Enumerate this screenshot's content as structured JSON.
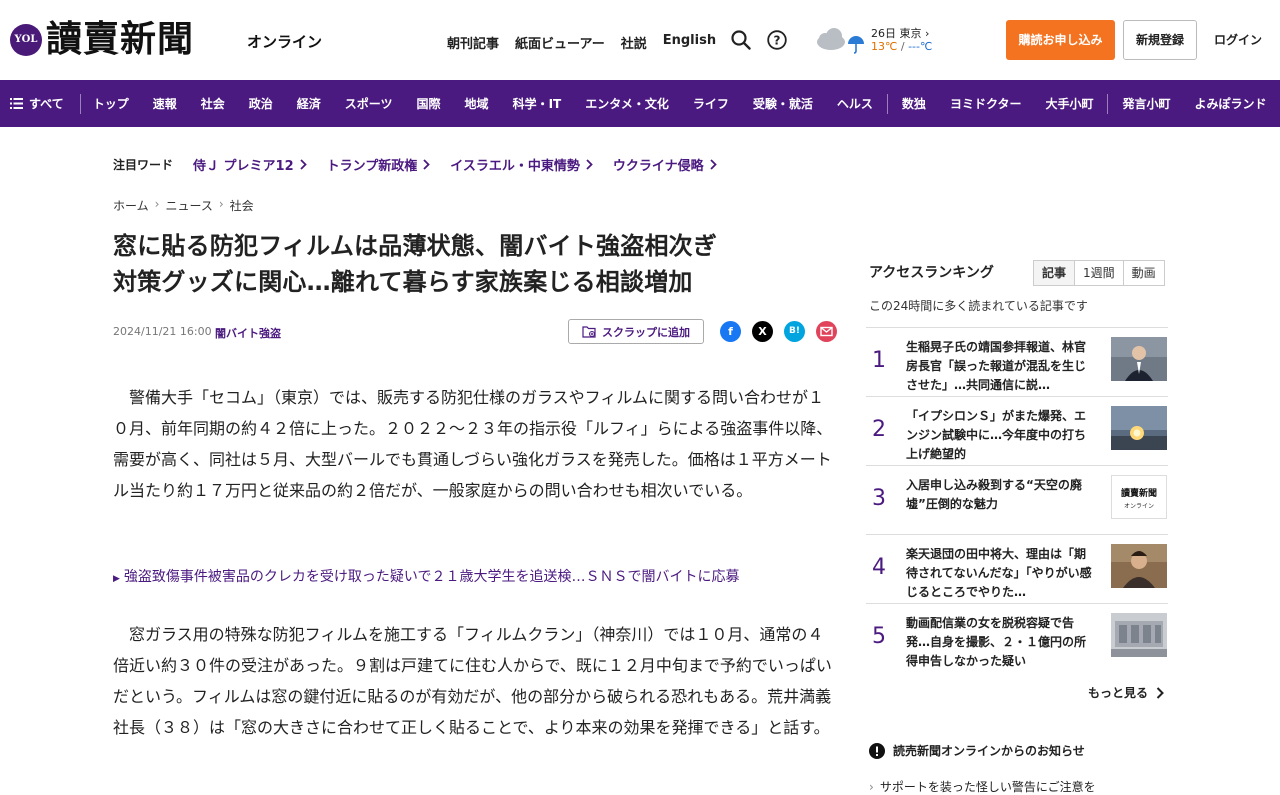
{
  "header": {
    "logo_badge": "YOL",
    "logo_main": "讀賣新聞",
    "logo_sub": "オンライン",
    "links": [
      "朝刊記事",
      "紙面ビューアー",
      "社説",
      "English"
    ],
    "weather": {
      "date_city": "26日 東京",
      "chevron": "›",
      "temp_high": "13℃",
      "sep": "/",
      "temp_low": "---℃"
    },
    "subscribe": "購読お申し込み",
    "register": "新規登録",
    "login": "ログイン"
  },
  "nav": {
    "all": "すべて",
    "items_a": [
      "トップ",
      "速報",
      "社会",
      "政治",
      "経済",
      "スポーツ",
      "国際",
      "地域",
      "科学・IT",
      "エンタメ・文化",
      "ライフ",
      "受験・就活",
      "ヘルス"
    ],
    "items_b": [
      "数独",
      "ヨミドクター",
      "大手小町"
    ],
    "items_c": [
      "発言小町",
      "よみぽランド"
    ]
  },
  "attention": {
    "label": "注目ワード",
    "links": [
      "侍Ｊ プレミア12",
      "トランプ新政権",
      "イスラエル・中東情勢",
      "ウクライナ侵略"
    ]
  },
  "breadcrumb": {
    "home": "ホーム",
    "news": "ニュース",
    "section": "社会",
    "sep": "›"
  },
  "article": {
    "title_line1": "窓に貼る防犯フィルムは品薄状態、闇バイト強盗相次ぎ",
    "title_line2": "対策グッズに関心…離れて暮らす家族案じる相談増加",
    "date": "2024/11/21 16:00",
    "tag": "闇バイト強盗",
    "scrap": "スクラップに追加",
    "para1": "警備大手「セコム」（東京）では、販売する防犯仕様のガラスやフィルムに関する問い合わせが１０月、前年同期の約４２倍に上った。２０２２～２３年の指示役「ルフィ」らによる強盗事件以降、需要が高く、同社は５月、大型バールでも貫通しづらい強化ガラスを発売した。価格は１平方メートル当たり約１７万円と従来品の約２倍だが、一般家庭からの問い合わせも相次いでいる。",
    "related": "強盗致傷事件被害品のクレカを受け取った疑いで２１歳大学生を追送検…ＳＮＳで闇バイトに応募",
    "para2": "窓ガラス用の特殊な防犯フィルムを施工する「フィルムクラン」（神奈川）では１０月、通常の４倍近い約３０件の受注があった。９割は戸建てに住む人からで、既に１２月中旬まで予約でいっぱいだという。フィルムは窓の鍵付近に貼るのが有効だが、他の部分から破られる恐れもある。荒井満義社長（３８）は「窓の大きさに合わせて正しく貼ることで、より本来の効果を発揮できる」と話す。"
  },
  "share": {
    "facebook": "f",
    "x": "X",
    "hatena": "B!"
  },
  "ranking": {
    "title": "アクセスランキング",
    "tabs": [
      "記事",
      "1週間",
      "動画"
    ],
    "subtitle": "この24時間に多く読まれている記事です",
    "items": [
      {
        "num": "1",
        "text": "生稲晃子氏の靖国参拝報道、林官房長官「誤った報道が混乱を生じさせた」…共同通信に説…"
      },
      {
        "num": "2",
        "text": "「イプシロンＳ」がまた爆発、エンジン試験中に…今年度中の打ち上げ絶望的"
      },
      {
        "num": "3",
        "text": "入居申し込み殺到する“天空の廃墟”圧倒的な魅力"
      },
      {
        "num": "4",
        "text": "楽天退団の田中将大、理由は「期待されてないんだな」「やりがい感じるところでやりた…"
      },
      {
        "num": "5",
        "text": "動画配信業の女を脱税容疑で告発…自身を撮影、２・１億円の所得申告しなかった疑い"
      }
    ],
    "thumb3_line1": "讀賣新聞",
    "thumb3_line2": "オンライン",
    "more": "もっと見る"
  },
  "notice": {
    "title": "読売新聞オンラインからのお知らせ",
    "item1": "サポートを装った怪しい警告にご注意を"
  },
  "colors": {
    "brand": "#4b1a80",
    "accent": "#f37321"
  }
}
